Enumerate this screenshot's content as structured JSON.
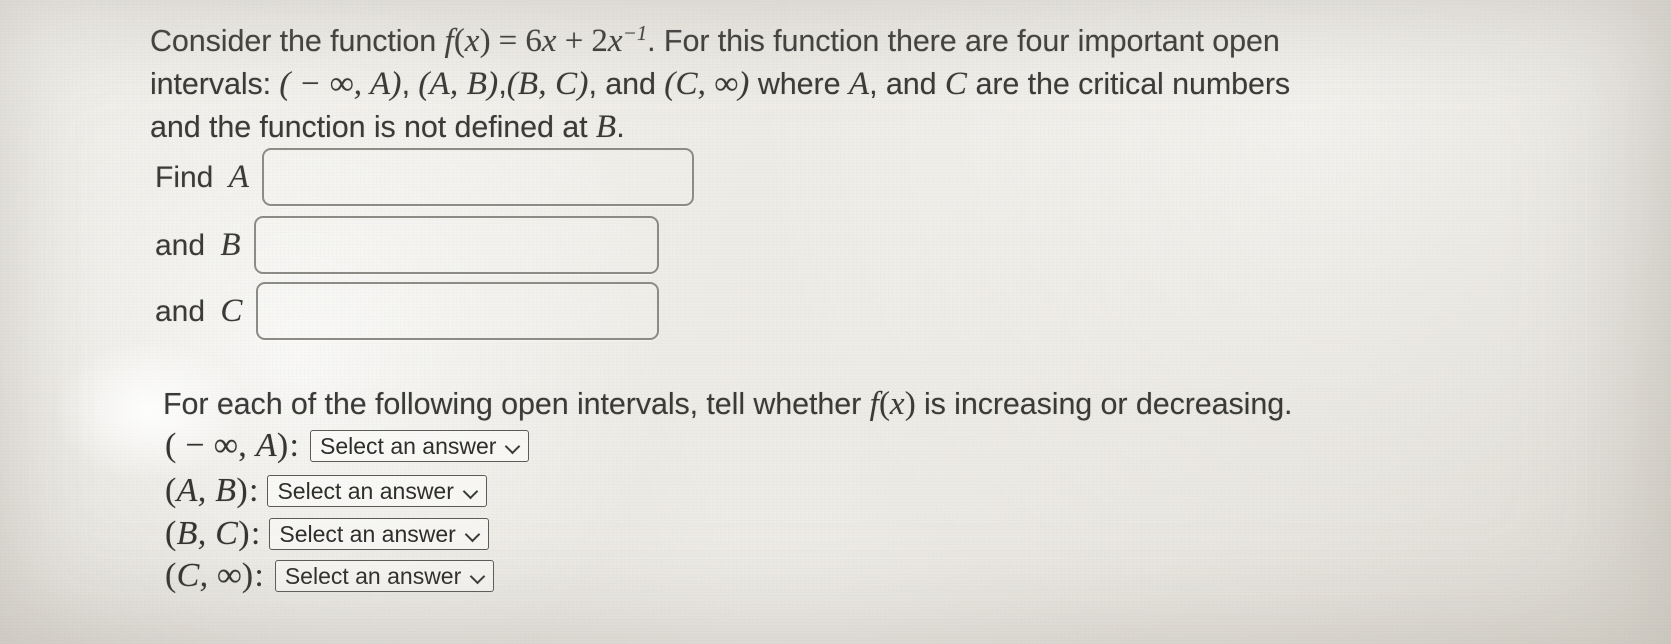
{
  "problem": {
    "intro": {
      "line1_part1": "Consider the function ",
      "function_f": "f",
      "function_open": "(",
      "function_var": "x",
      "function_close": ")",
      "function_equals": " = ",
      "function_coef": "6",
      "function_x1": "x",
      "function_plus": " + ",
      "function_coef2": "2",
      "function_x2": "x",
      "function_exp": "−1",
      "line1_part2": ". For this function there are four important open",
      "line2_part1": "intervals: ",
      "interval_1": "( − ∞, A)",
      "interval_1_sep": ", ",
      "interval_2": "(A, B)",
      "interval_2_sep": ",",
      "interval_3": "(B, C)",
      "line2_mid": ", and ",
      "interval_4": "(C, ∞)",
      "line2_part2": " where ",
      "var_A": "A",
      "line2_part3": ", and ",
      "var_C": "C",
      "line2_part4": " are the critical numbers",
      "line3_part1": "and the function is not defined at ",
      "var_B": "B",
      "line3_part2": "."
    },
    "fields": [
      {
        "label_text": "Find ",
        "label_var": "A",
        "value": "",
        "placeholder": ""
      },
      {
        "label_text": "and ",
        "label_var": "B",
        "value": "",
        "placeholder": ""
      },
      {
        "label_text": "and ",
        "label_var": "C",
        "value": "",
        "placeholder": ""
      }
    ],
    "prompt2": {
      "part1": "For each of the following open intervals, tell whether ",
      "fx_f": "f",
      "fx_open": "(",
      "fx_var": "x",
      "fx_close": ")",
      "part2": " is increasing or decreasing."
    },
    "intervals": [
      {
        "open_paren": "(",
        "body_prefix": " − ∞, ",
        "body_var": "A",
        "close_paren": ")",
        "colon": ":",
        "selected": "Select an answer",
        "chevron": "chevron-down"
      },
      {
        "open_paren": "(",
        "body_prefix": "",
        "body_var": "A, B",
        "close_paren": ")",
        "colon": ":",
        "selected": "Select an answer",
        "chevron": "chevron-down"
      },
      {
        "open_paren": "(",
        "body_prefix": "",
        "body_var": "B, C",
        "close_paren": ")",
        "colon": ":",
        "selected": "Select an answer",
        "chevron": "chevron-down"
      },
      {
        "open_paren": "(",
        "body_prefix": "",
        "body_var": "C, ∞",
        "close_paren": ")",
        "colon": ":",
        "selected": "Select an answer",
        "chevron": "chevron-down"
      }
    ]
  },
  "colors": {
    "paper": "#f0efeb",
    "ink": "#3a3a38",
    "field_border": "#8d8b86",
    "select_border": "#5c5b58"
  }
}
